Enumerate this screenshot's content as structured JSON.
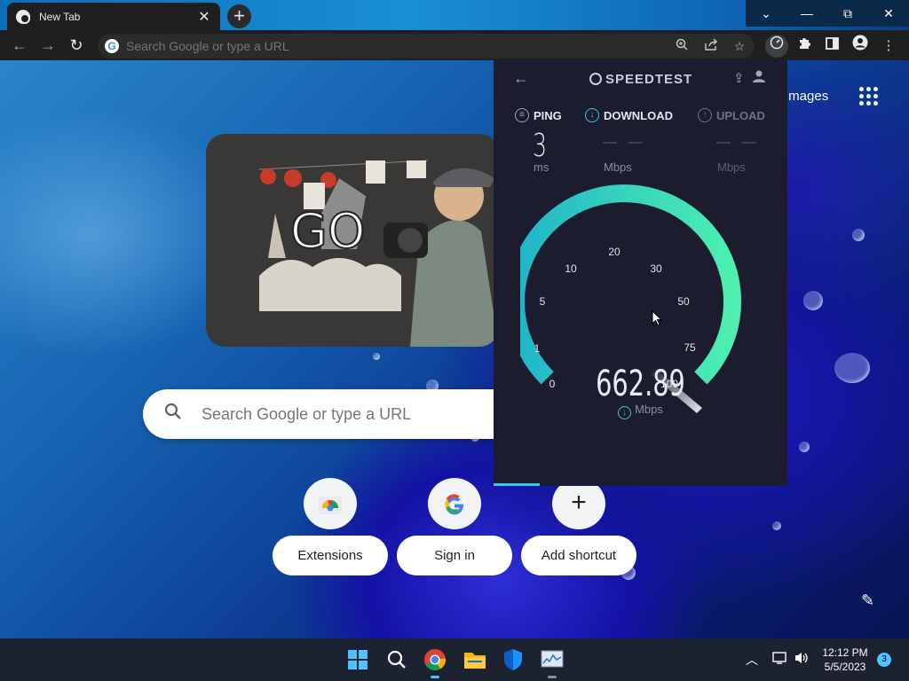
{
  "browser": {
    "tab": {
      "title": "New Tab",
      "close": "✕"
    },
    "new_tab": "+",
    "window_controls": {
      "tablist": "⌄",
      "minimize": "—",
      "restore": "⧉",
      "close": "✕"
    },
    "toolbar": {
      "back": "←",
      "forward": "→",
      "reload": "↻",
      "omnibox_placeholder": "Search Google or type a URL",
      "google_badge": "G",
      "icons": [
        "zoom-icon",
        "share-icon",
        "bookmark-star-icon",
        "speedtest-extension-icon",
        "extensions-puzzle-icon",
        "side-panel-icon",
        "profile-icon",
        "menu-icon"
      ]
    }
  },
  "ntp": {
    "header": {
      "images_label": "Images"
    },
    "search": {
      "placeholder": "Search Google or type a URL"
    },
    "doodle_text": "GO",
    "shortcuts": [
      {
        "label": "Extensions",
        "icon": "chrome-web-store-icon"
      },
      {
        "label": "Sign in",
        "icon": "google-g-icon"
      },
      {
        "label": "Add shortcut",
        "icon": "plus-icon",
        "glyph": "+"
      }
    ],
    "customize_icon": "✎"
  },
  "speedtest": {
    "title": "SPEEDTEST",
    "metrics": {
      "ping": {
        "label": "PING",
        "value": "3",
        "unit": "ms"
      },
      "download": {
        "label": "DOWNLOAD",
        "value": "— —",
        "unit": "Mbps"
      },
      "upload": {
        "label": "UPLOAD",
        "value": "— —",
        "unit": "Mbps"
      }
    },
    "gauge_ticks": [
      "0",
      "1",
      "5",
      "10",
      "20",
      "30",
      "50",
      "75",
      "100"
    ],
    "current_speed": "662.89",
    "current_unit": "Mbps",
    "colors": {
      "arc_start": "#1fb5c9",
      "arc_end": "#4ef0b0",
      "background": "#1b1d2e"
    }
  },
  "taskbar": {
    "apps": [
      "windows-start-icon",
      "search-icon",
      "chrome-icon",
      "file-explorer-icon",
      "windows-security-icon",
      "resource-monitor-icon"
    ],
    "time": "12:12 PM",
    "date": "5/5/2023",
    "notification_count": "3"
  }
}
